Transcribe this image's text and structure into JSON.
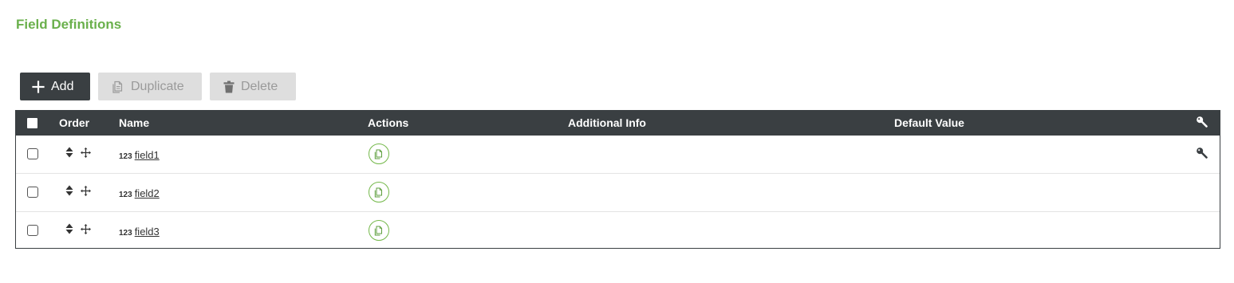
{
  "page": {
    "title": "Field Definitions"
  },
  "colors": {
    "accent": "#6ab04c",
    "dark": "#3a3f42",
    "disabled_bg": "#dedede",
    "icon_green": "#74b84a"
  },
  "toolbar": {
    "add_label": "Add",
    "duplicate_label": "Duplicate",
    "delete_label": "Delete",
    "add_icon": "plus-icon",
    "duplicate_icon": "copy-icon",
    "delete_icon": "trash-icon"
  },
  "table": {
    "columns": {
      "order": "Order",
      "name": "Name",
      "actions": "Actions",
      "additional_info": "Additional Info",
      "default_value": "Default Value"
    },
    "header_key_icon": "key-icon",
    "rows": [
      {
        "type": "123",
        "name": "field1",
        "key": true
      },
      {
        "type": "123",
        "name": "field2",
        "key": false
      },
      {
        "type": "123",
        "name": "field3",
        "key": false
      }
    ]
  }
}
